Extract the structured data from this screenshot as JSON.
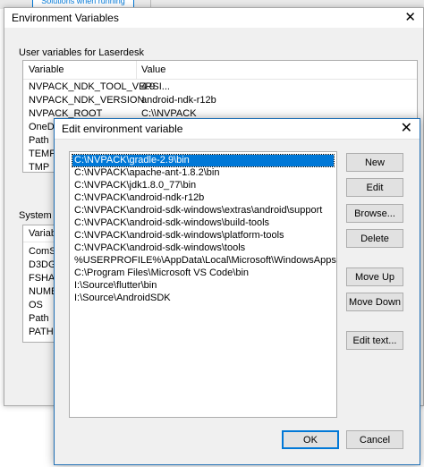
{
  "background_app": {
    "button_label": "Solutions when running"
  },
  "env_window": {
    "title": "Environment Variables",
    "user_group_label": "User variables for Laserdesk",
    "user_columns": [
      "Variable",
      "Value"
    ],
    "user_rows": [
      {
        "variable": "NVPACK_NDK_TOOL_VERSI...",
        "value": "4.9"
      },
      {
        "variable": "NVPACK_NDK_VERSION",
        "value": "android-ndk-r12b"
      },
      {
        "variable": "NVPACK_ROOT",
        "value": "C:\\\\NVPACK"
      },
      {
        "variable": "OneDrive",
        "value": ""
      },
      {
        "variable": "Path",
        "value": ""
      },
      {
        "variable": "TEMP",
        "value": ""
      },
      {
        "variable": "TMP",
        "value": ""
      }
    ],
    "system_group_label": "System va",
    "system_columns": [
      "Variable"
    ],
    "system_rows": [
      "ComSpe",
      "D3DGEA",
      "FSHARP",
      "NUMBE",
      "OS",
      "Path",
      "PATHEX"
    ]
  },
  "edit_dialog": {
    "title": "Edit environment variable",
    "paths": [
      "C:\\NVPACK\\gradle-2.9\\bin",
      "C:\\NVPACK\\apache-ant-1.8.2\\bin",
      "C:\\NVPACK\\jdk1.8.0_77\\bin",
      "C:\\NVPACK\\android-ndk-r12b",
      "C:\\NVPACK\\android-sdk-windows\\extras\\android\\support",
      "C:\\NVPACK\\android-sdk-windows\\build-tools",
      "C:\\NVPACK\\android-sdk-windows\\platform-tools",
      "C:\\NVPACK\\android-sdk-windows\\tools",
      "%USERPROFILE%\\AppData\\Local\\Microsoft\\WindowsApps",
      "C:\\Program Files\\Microsoft VS Code\\bin",
      "I:\\Source\\flutter\\bin",
      "I:\\Source\\AndroidSDK"
    ],
    "selected_index": 0,
    "buttons": {
      "new": "New",
      "edit": "Edit",
      "browse": "Browse...",
      "delete": "Delete",
      "move_up": "Move Up",
      "move_down": "Move Down",
      "edit_text": "Edit text...",
      "ok": "OK",
      "cancel": "Cancel"
    },
    "accent_color": "#0078d7"
  }
}
